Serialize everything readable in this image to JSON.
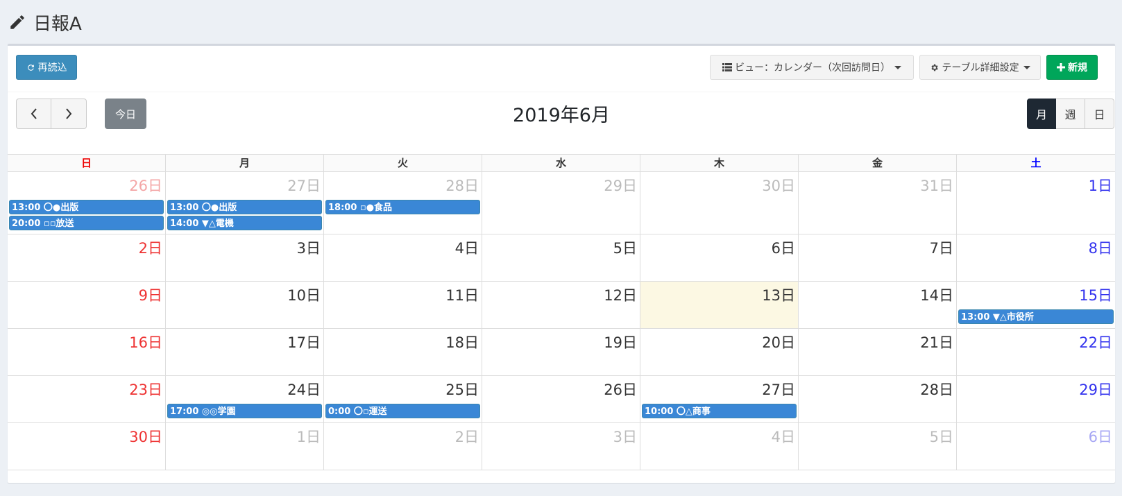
{
  "page": {
    "title": "日報A"
  },
  "toolbar": {
    "reload_label": "再読込",
    "view_label": "ビュー：カレンダー（次回訪問日）",
    "table_settings_label": "テーブル詳細設定",
    "new_label": "新規"
  },
  "calendar": {
    "title": "2019年6月",
    "today_label": "今日",
    "modes": [
      "月",
      "週",
      "日"
    ],
    "weekdays": [
      "日",
      "月",
      "火",
      "水",
      "木",
      "金",
      "土"
    ],
    "weeks": [
      {
        "days": [
          {
            "label": "26日",
            "other": true,
            "events": [
              "13:00 〇●出版",
              "20:00 ▫▫放送"
            ]
          },
          {
            "label": "27日",
            "other": true,
            "events": [
              "13:00 〇●出版",
              "14:00 ▼△電機"
            ]
          },
          {
            "label": "28日",
            "other": true,
            "events": [
              "18:00 ▫●食品"
            ]
          },
          {
            "label": "29日",
            "other": true,
            "events": []
          },
          {
            "label": "30日",
            "other": true,
            "events": []
          },
          {
            "label": "31日",
            "other": true,
            "events": []
          },
          {
            "label": "1日",
            "other": false,
            "events": []
          }
        ]
      },
      {
        "days": [
          {
            "label": "2日",
            "events": []
          },
          {
            "label": "3日",
            "events": []
          },
          {
            "label": "4日",
            "events": []
          },
          {
            "label": "5日",
            "events": []
          },
          {
            "label": "6日",
            "events": []
          },
          {
            "label": "7日",
            "events": []
          },
          {
            "label": "8日",
            "events": []
          }
        ]
      },
      {
        "days": [
          {
            "label": "9日",
            "events": []
          },
          {
            "label": "10日",
            "events": []
          },
          {
            "label": "11日",
            "events": []
          },
          {
            "label": "12日",
            "events": []
          },
          {
            "label": "13日",
            "today": true,
            "events": []
          },
          {
            "label": "14日",
            "events": []
          },
          {
            "label": "15日",
            "events": [
              "13:00 ▼△市役所"
            ]
          }
        ]
      },
      {
        "days": [
          {
            "label": "16日",
            "events": []
          },
          {
            "label": "17日",
            "events": []
          },
          {
            "label": "18日",
            "events": []
          },
          {
            "label": "19日",
            "events": []
          },
          {
            "label": "20日",
            "events": []
          },
          {
            "label": "21日",
            "events": []
          },
          {
            "label": "22日",
            "events": []
          }
        ]
      },
      {
        "days": [
          {
            "label": "23日",
            "events": []
          },
          {
            "label": "24日",
            "events": [
              "17:00 ◎◎学園"
            ]
          },
          {
            "label": "25日",
            "events": [
              "0:00 〇▫運送"
            ]
          },
          {
            "label": "26日",
            "events": []
          },
          {
            "label": "27日",
            "events": [
              "10:00 〇△商事"
            ]
          },
          {
            "label": "28日",
            "events": []
          },
          {
            "label": "29日",
            "events": []
          }
        ]
      },
      {
        "days": [
          {
            "label": "30日",
            "events": []
          },
          {
            "label": "1日",
            "other": true,
            "events": []
          },
          {
            "label": "2日",
            "other": true,
            "events": []
          },
          {
            "label": "3日",
            "other": true,
            "events": []
          },
          {
            "label": "4日",
            "other": true,
            "events": []
          },
          {
            "label": "5日",
            "other": true,
            "events": []
          },
          {
            "label": "6日",
            "other": true,
            "events": []
          }
        ]
      }
    ]
  },
  "colors": {
    "primary": "#3c8dbc",
    "success": "#00a65a",
    "event": "#3a87d6",
    "today_bg": "#fcf8e3",
    "sunday": "#ee3333",
    "saturday": "#3333ee"
  }
}
